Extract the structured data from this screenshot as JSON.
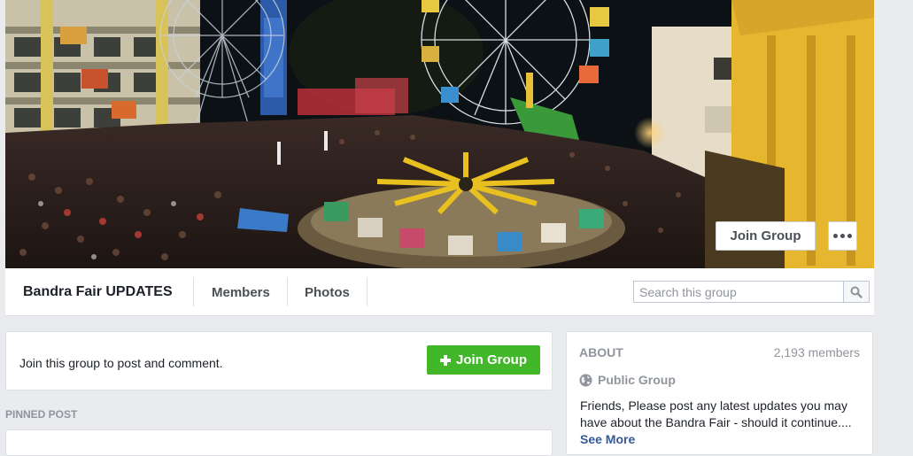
{
  "cover": {
    "join_label": "Join Group",
    "more_icon": "ellipsis-icon"
  },
  "nav": {
    "group_name": "Bandra Fair UPDATES",
    "members_label": "Members",
    "photos_label": "Photos",
    "search_placeholder": "Search this group",
    "search_icon": "magnifier-icon"
  },
  "join_card": {
    "prompt": "Join this group to post and comment.",
    "button_label": "Join Group"
  },
  "pinned": {
    "label": "PINNED POST"
  },
  "about": {
    "title": "ABOUT",
    "members": "2,193 members",
    "privacy": "Public Group",
    "description": "Friends, Please post any latest updates you may have about the Bandra Fair - should it continue.... ",
    "see_more": "See More"
  },
  "colors": {
    "join_green": "#42b72a",
    "link_blue": "#365899",
    "muted_gray": "#90949c",
    "page_bg": "#e9ebee"
  }
}
